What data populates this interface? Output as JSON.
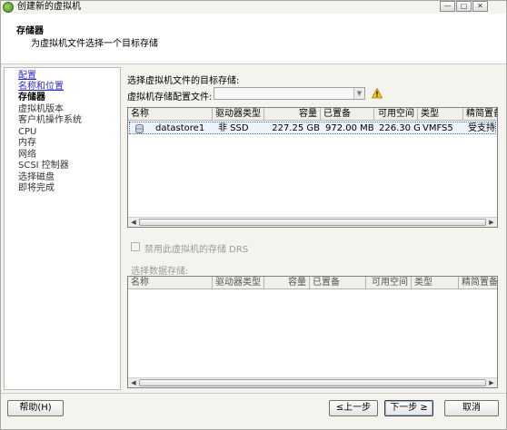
{
  "window": {
    "title": "创建新的虚拟机",
    "controls": [
      "—",
      "▢",
      "✕"
    ]
  },
  "header": {
    "title": "存储器",
    "subtitle": "为虚拟机文件选择一个目标存储"
  },
  "nav": {
    "items": [
      {
        "label": "配置",
        "state": "link"
      },
      {
        "label": "名称和位置",
        "state": "link"
      },
      {
        "label": "存储器",
        "state": "current"
      },
      {
        "label": "虚拟机版本",
        "state": "pending"
      },
      {
        "label": "客户机操作系统",
        "state": "pending"
      },
      {
        "label": "CPU",
        "state": "pending"
      },
      {
        "label": "内存",
        "state": "pending"
      },
      {
        "label": "网络",
        "state": "pending"
      },
      {
        "label": "SCSI 控制器",
        "state": "pending"
      },
      {
        "label": "选择磁盘",
        "state": "pending"
      },
      {
        "label": "即将完成",
        "state": "pending"
      }
    ]
  },
  "main": {
    "select_label": "选择虚拟机文件的目标存储:",
    "profile_label": "虚拟机存储配置文件:",
    "profile_value": "",
    "table": {
      "columns": [
        "名称",
        "驱动器类型",
        "容量",
        "已置备",
        "可用空间",
        "类型",
        "精简置备"
      ],
      "rows": [
        {
          "name": "datastore1",
          "drive_type": "非 SSD",
          "capacity": "227.25 GB",
          "provisioned": "972.00 MB",
          "free": "226.30 GB",
          "type": "VMFS5",
          "thin": "受支持"
        }
      ]
    },
    "drs_checkbox": {
      "label": "禁用此虚拟机的存储 DRS",
      "checked": false,
      "enabled": false
    },
    "datastore_label": "选择数据存储:",
    "table2": {
      "columns": [
        "名称",
        "驱动器类型",
        "容量",
        "已置备",
        "可用空间",
        "类型",
        "精简置备"
      ]
    }
  },
  "footer": {
    "help": "帮助(H)",
    "back": "≤上一步",
    "next": "下一步 ≥",
    "cancel": "取消"
  },
  "colors": {
    "link": "#2c2cc2",
    "disabled_text": "#9a9a9a",
    "window_bg": "#f4f3ee"
  },
  "icons": {
    "warning": "warning-icon",
    "datastore": "datastore-icon"
  }
}
